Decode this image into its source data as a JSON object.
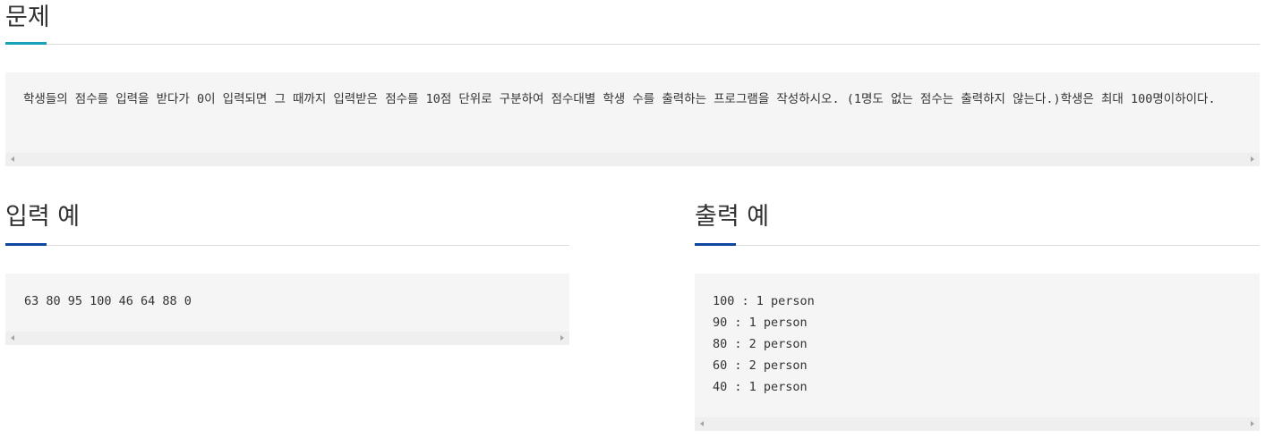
{
  "problem": {
    "heading": "문제",
    "text": "학생들의 점수를 입력을 받다가 0이 입력되면 그 때까지 입력받은 점수를 10점 단위로 구분하여 점수대별 학생 수를 출력하는 프로그램을 작성하시오. (1명도 없는 점수는 출력하지 않는다.)학생은 최대 100명이하이다."
  },
  "input_example": {
    "heading": "입력 예",
    "lines": [
      "63 80 95 100 46 64 88 0"
    ]
  },
  "output_example": {
    "heading": "출력 예",
    "lines": [
      "100 : 1 person",
      "90 : 1 person",
      "80 : 2 person",
      "60 : 2 person",
      "40 : 1 person"
    ]
  },
  "colors": {
    "problem_accent": "#17a2b8",
    "example_accent": "#0d47a1",
    "code_background": "#f5f5f6",
    "scrollbar_track": "#efefef",
    "divider": "#dcdcdc",
    "text": "#333333"
  }
}
